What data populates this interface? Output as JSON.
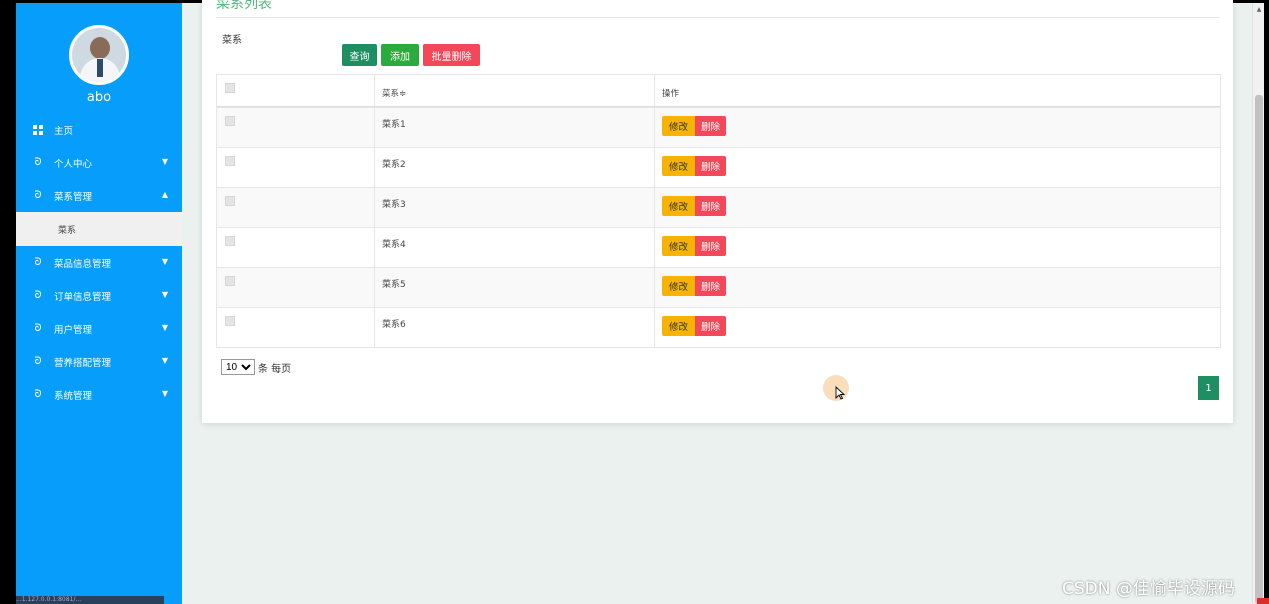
{
  "sidebar": {
    "username": "abo",
    "items": [
      {
        "label": "主页",
        "icon": "grid-icon",
        "expanded": null
      },
      {
        "label": "个人中心",
        "icon": "swirl-icon",
        "expanded": false
      },
      {
        "label": "菜系管理",
        "icon": "swirl-icon",
        "expanded": true
      },
      {
        "label": "菜品信息管理",
        "icon": "swirl-icon",
        "expanded": false
      },
      {
        "label": "订单信息管理",
        "icon": "swirl-icon",
        "expanded": false
      },
      {
        "label": "用户管理",
        "icon": "swirl-icon",
        "expanded": false
      },
      {
        "label": "营养搭配管理",
        "icon": "swirl-icon",
        "expanded": false
      },
      {
        "label": "系统管理",
        "icon": "swirl-icon",
        "expanded": false
      }
    ],
    "submenu_label": "菜系",
    "bottom_text": "...1.127.0.0.1:8081/..."
  },
  "main": {
    "card_title": "菜系列表",
    "search": {
      "label": "菜系",
      "value": "",
      "placeholder": ""
    },
    "buttons": {
      "query": "查询",
      "add": "添加",
      "batch_delete": "批量删除"
    },
    "table": {
      "headers": {
        "name": "菜系≑",
        "ops": "操作"
      },
      "rows": [
        {
          "name": "菜系1"
        },
        {
          "name": "菜系2"
        },
        {
          "name": "菜系3"
        },
        {
          "name": "菜系4"
        },
        {
          "name": "菜系5"
        },
        {
          "name": "菜系6"
        }
      ],
      "edit_label": "修改",
      "delete_label": "删除"
    },
    "pagination": {
      "page_size": "10",
      "page_size_suffix": "条 每页",
      "current_page": "1"
    }
  },
  "watermark": "CSDN @佳愉毕设源码",
  "colors": {
    "sidebar": "#069efa",
    "primary_green": "#1e8f62",
    "add_green": "#2bab3d",
    "danger": "#f4485a",
    "warning": "#f6b300",
    "title_green": "#53b87a"
  }
}
